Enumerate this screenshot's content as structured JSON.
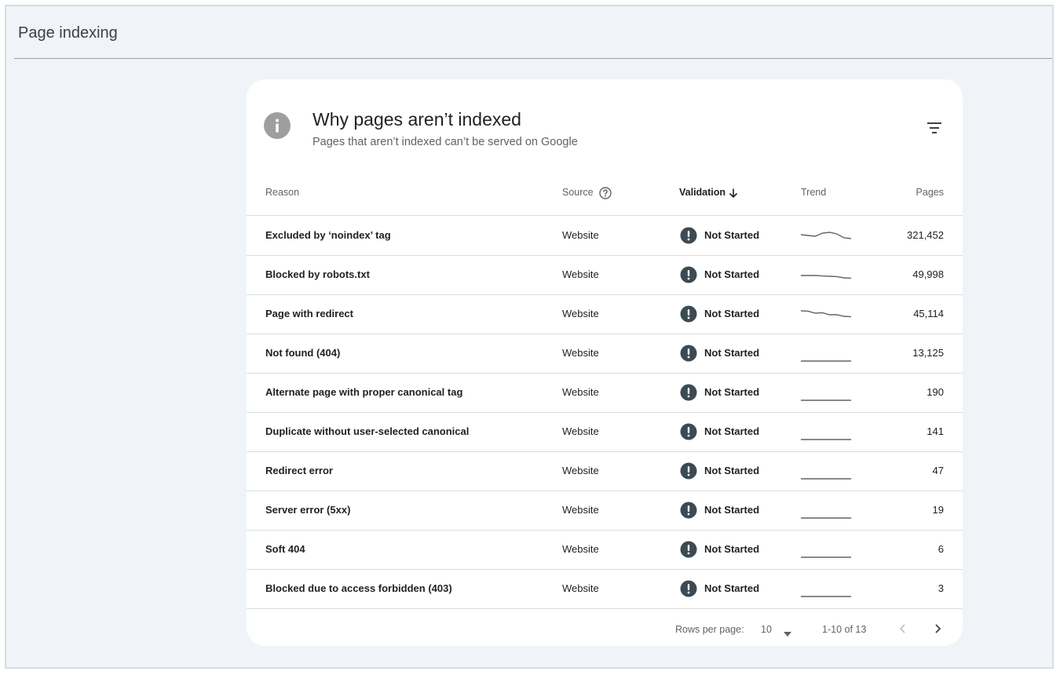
{
  "page": {
    "title": "Page indexing"
  },
  "card": {
    "icon": "info-icon",
    "title": "Why pages aren’t indexed",
    "subtitle": "Pages that aren’t indexed can’t be served on Google",
    "filter_icon": "filter-icon"
  },
  "table": {
    "headers": {
      "reason": "Reason",
      "source": "Source",
      "validation": "Validation",
      "trend": "Trend",
      "pages": "Pages"
    },
    "sort_icon": "arrow-down-icon",
    "help_icon": "help-circle-icon",
    "rows": [
      {
        "reason": "Excluded by ‘noindex’ tag",
        "source": "Website",
        "validation": "Not Started",
        "pages": "321,452",
        "trend": [
          0.45,
          0.5,
          0.55,
          0.35,
          0.3,
          0.4,
          0.65,
          0.7
        ]
      },
      {
        "reason": "Blocked by robots.txt",
        "source": "Website",
        "validation": "Not Started",
        "pages": "49,998",
        "trend": [
          0.55,
          0.55,
          0.55,
          0.58,
          0.6,
          0.62,
          0.7,
          0.72
        ]
      },
      {
        "reason": "Page with redirect",
        "source": "Website",
        "validation": "Not Started",
        "pages": "45,114",
        "trend": [
          0.3,
          0.32,
          0.45,
          0.42,
          0.55,
          0.55,
          0.65,
          0.68
        ]
      },
      {
        "reason": "Not found (404)",
        "source": "Website",
        "validation": "Not Started",
        "pages": "13,125",
        "trend": [
          1,
          1,
          1,
          1,
          1,
          1,
          1,
          1
        ]
      },
      {
        "reason": "Alternate page with proper canonical tag",
        "source": "Website",
        "validation": "Not Started",
        "pages": "190",
        "trend": [
          1,
          1,
          1,
          1,
          1,
          1,
          1,
          1
        ]
      },
      {
        "reason": "Duplicate without user-selected canonical",
        "source": "Website",
        "validation": "Not Started",
        "pages": "141",
        "trend": [
          1,
          1,
          1,
          1,
          1,
          1,
          1,
          1
        ]
      },
      {
        "reason": "Redirect error",
        "source": "Website",
        "validation": "Not Started",
        "pages": "47",
        "trend": [
          1,
          1,
          1,
          1,
          1,
          1,
          1,
          1
        ]
      },
      {
        "reason": "Server error (5xx)",
        "source": "Website",
        "validation": "Not Started",
        "pages": "19",
        "trend": [
          1,
          1,
          1,
          1,
          1,
          1,
          1,
          1
        ]
      },
      {
        "reason": "Soft 404",
        "source": "Website",
        "validation": "Not Started",
        "pages": "6",
        "trend": [
          1,
          1,
          1,
          1,
          1,
          1,
          1,
          1
        ]
      },
      {
        "reason": "Blocked due to access forbidden (403)",
        "source": "Website",
        "validation": "Not Started",
        "pages": "3",
        "trend": [
          1,
          1,
          1,
          1,
          1,
          1,
          1,
          1
        ]
      }
    ]
  },
  "pagination": {
    "rows_per_page_label": "Rows per page:",
    "rows_per_page_value": "10",
    "range": "1-10 of 13",
    "prev_icon": "chevron-left-icon",
    "next_icon": "chevron-right-icon"
  },
  "colors": {
    "background": "#f0f4f9",
    "card": "#ffffff",
    "status_icon": "#3c4a54",
    "info_icon": "#9e9e9e",
    "divider": "#dadce0"
  }
}
